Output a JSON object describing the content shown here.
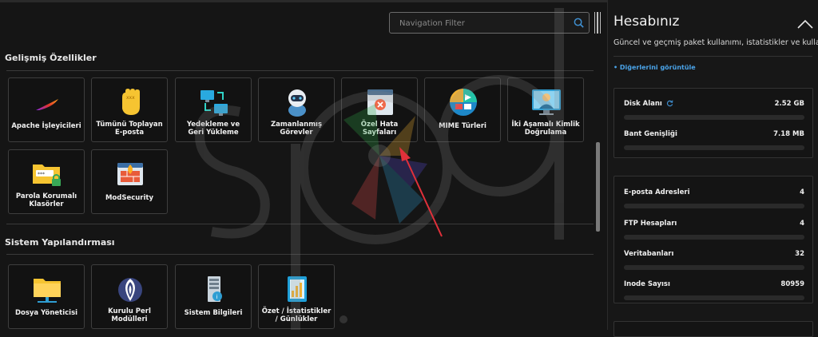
{
  "nav_filter": {
    "placeholder": "Navigation Filter"
  },
  "sections": {
    "advanced": {
      "title": "Gelişmiş Özellikler"
    },
    "system": {
      "title": "Sistem Yapılandırması"
    }
  },
  "tiles_advanced": [
    {
      "label": "Apache İşleyicileri",
      "icon": "apache-feather-icon"
    },
    {
      "label": "Tümünü Toplayan E-posta",
      "icon": "catch-all-hand-icon"
    },
    {
      "label": "Yedekleme ve Geri Yükleme",
      "icon": "backup-computers-icon"
    },
    {
      "label": "Zamanlanmış Görevler",
      "icon": "robot-icon"
    },
    {
      "label": "Özel Hata Sayfaları",
      "icon": "error-page-icon"
    },
    {
      "label": "MIME Türleri",
      "icon": "mime-types-icon"
    },
    {
      "label": "İki Aşamalı Kimlik Doğrulama",
      "icon": "two-factor-icon"
    },
    {
      "label": "Parola Korumalı Klasörler",
      "icon": "locked-folder-icon"
    },
    {
      "label": "ModSecurity",
      "icon": "firewall-icon"
    }
  ],
  "tiles_system": [
    {
      "label": "Dosya Yöneticisi",
      "icon": "file-manager-icon"
    },
    {
      "label": "Kurulu Perl Modülleri",
      "icon": "perl-onion-icon"
    },
    {
      "label": "Sistem Bilgileri",
      "icon": "server-info-icon"
    },
    {
      "label": "Özet / İstatistikler / Günlükler",
      "icon": "stats-logs-icon"
    }
  ],
  "account": {
    "title": "Hesabınız",
    "description": "Güncel ve geçmiş paket kullanımı, istatistikler ve kulla",
    "more_link": "• Diğerlerini görüntüle",
    "usage": [
      {
        "name": "Disk Alanı",
        "value": "2.52 GB",
        "fill": 0.0
      },
      {
        "name": "Bant Genişliği",
        "value": "7.18 MB",
        "fill": 0.0
      }
    ],
    "counts": [
      {
        "name": "E-posta Adresleri",
        "value": "4",
        "fill": 0.0
      },
      {
        "name": "FTP Hesapları",
        "value": "4",
        "fill": 0.0
      },
      {
        "name": "Veritabanları",
        "value": "32",
        "fill": 0.0
      },
      {
        "name": "Inode Sayısı",
        "value": "80959",
        "fill": 0.0
      }
    ]
  },
  "colors": {
    "accent": "#4aa3e8",
    "arrow": "#e0303a"
  }
}
